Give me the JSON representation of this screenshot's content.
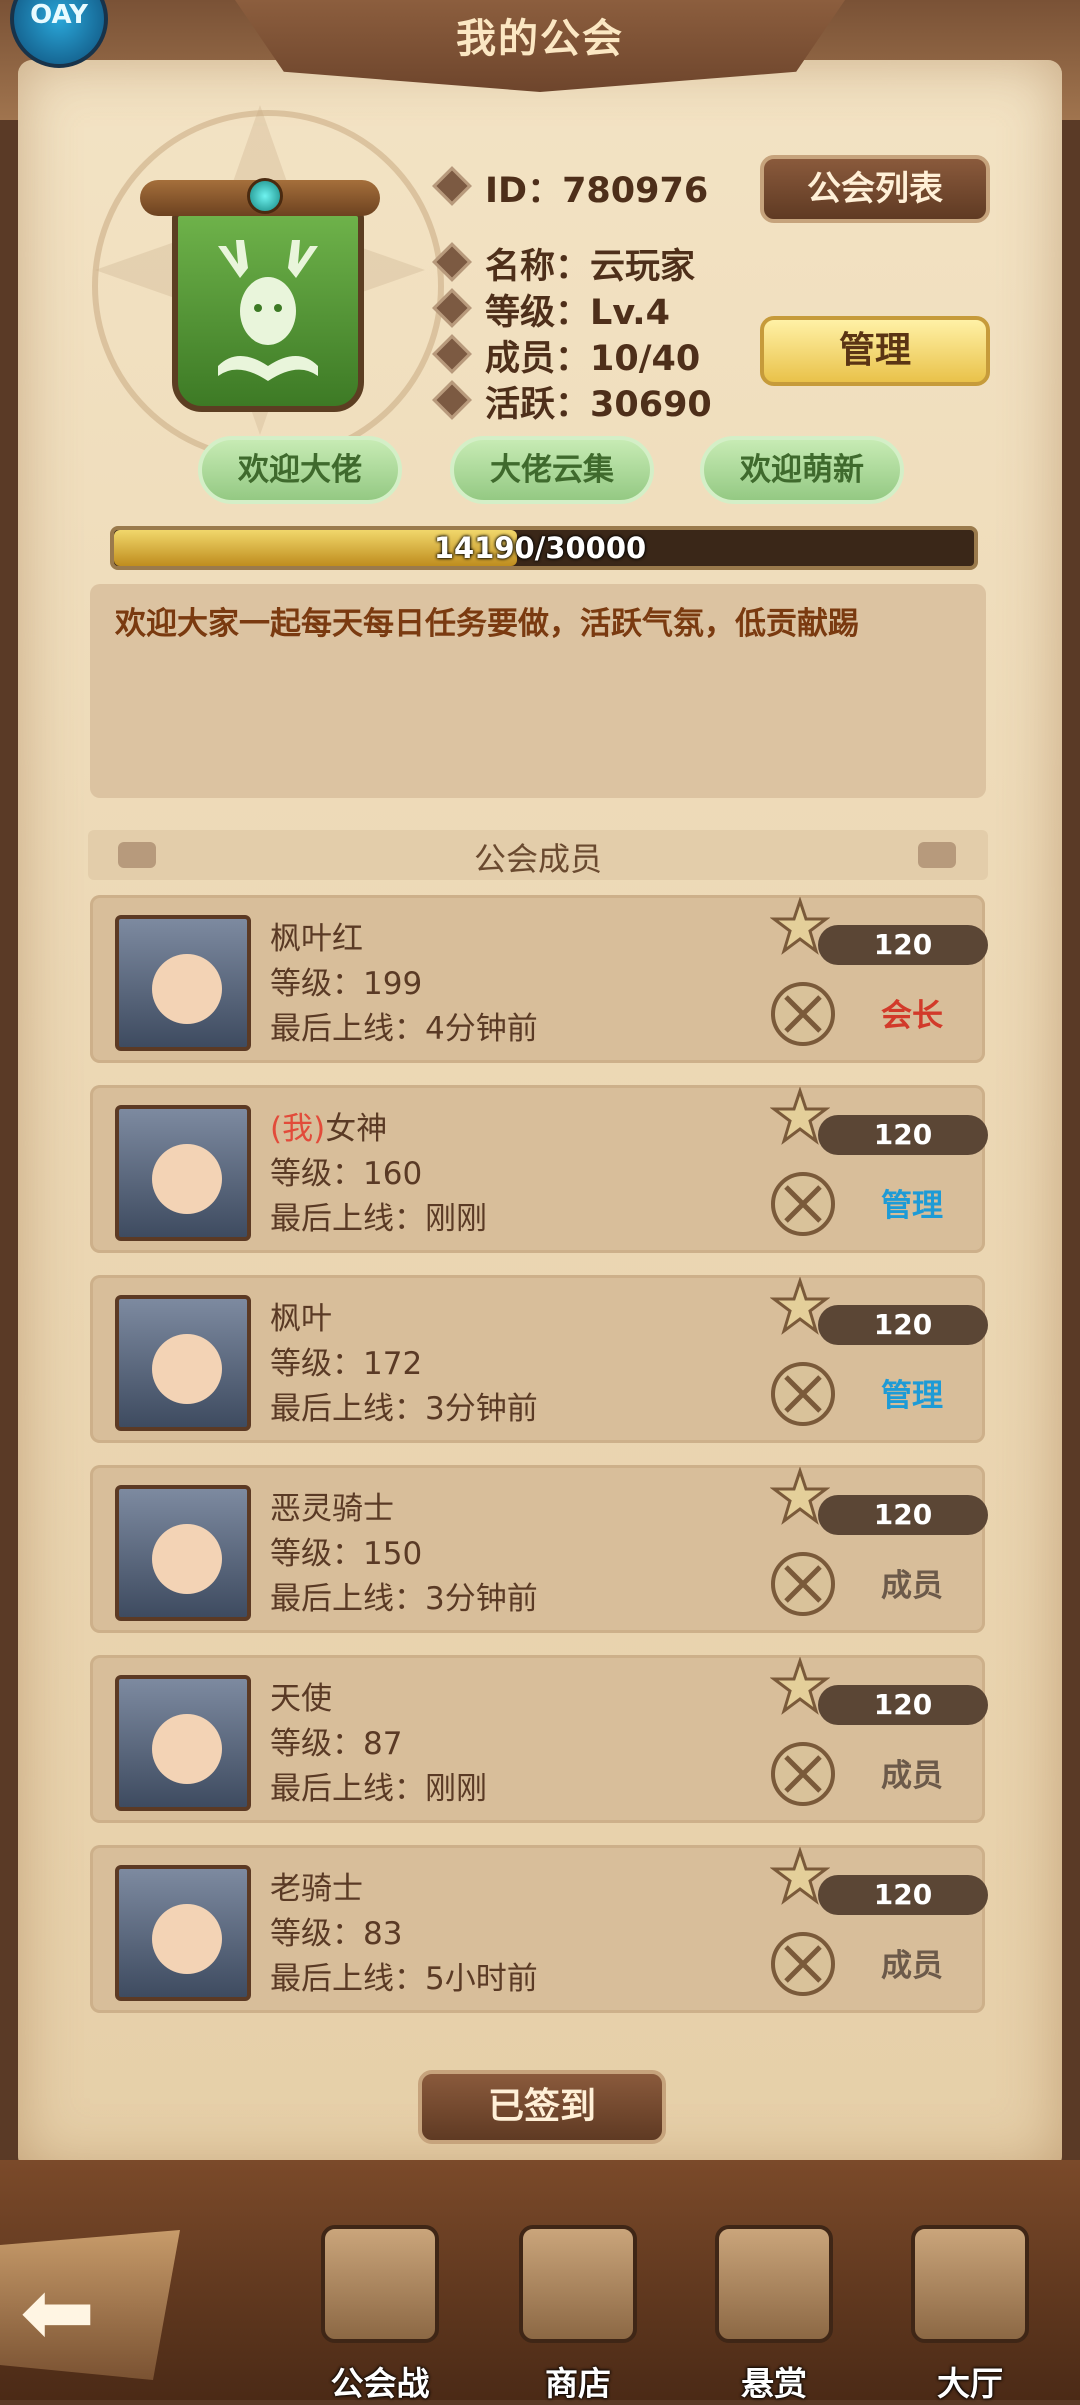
{
  "header": {
    "title": "我的公会",
    "corner_badge": "OAY"
  },
  "guild": {
    "id_label": "ID：",
    "id_value": "780976",
    "name_label": "名称：",
    "name_value": "云玩家",
    "level_label": "等级：",
    "level_value": "Lv.4",
    "members_label": "成员：",
    "members_value": "10/40",
    "activity_label": "活跃：",
    "activity_value": "30690"
  },
  "buttons": {
    "guild_list": "公会列表",
    "manage": "管理",
    "signed": "已签到"
  },
  "tags": [
    "欢迎大佬",
    "大佬云集",
    "欢迎萌新"
  ],
  "progress": {
    "text": "14190/30000",
    "fraction": 0.473
  },
  "notice": "欢迎大家一起每天每日任务要做，活跃气氛，低贡献踢",
  "members_title": "公会成员",
  "members": [
    {
      "prefix": "",
      "name": "枫叶红",
      "level": "等级：199",
      "last_online": "最后上线：4分钟前",
      "power": "120",
      "role": "会长",
      "role_type": "leader"
    },
    {
      "prefix": "(我)",
      "name": "女神",
      "level": "等级：160",
      "last_online": "最后上线：刚刚",
      "power": "120",
      "role": "管理",
      "role_type": "admin"
    },
    {
      "prefix": "",
      "name": "枫叶",
      "level": "等级：172",
      "last_online": "最后上线：3分钟前",
      "power": "120",
      "role": "管理",
      "role_type": "admin"
    },
    {
      "prefix": "",
      "name": "恶灵骑士",
      "level": "等级：150",
      "last_online": "最后上线：3分钟前",
      "power": "120",
      "role": "成员",
      "role_type": "member"
    },
    {
      "prefix": "",
      "name": "天使",
      "level": "等级：87",
      "last_online": "最后上线：刚刚",
      "power": "120",
      "role": "成员",
      "role_type": "member"
    },
    {
      "prefix": "",
      "name": "老骑士",
      "level": "等级：83",
      "last_online": "最后上线：5小时前",
      "power": "120",
      "role": "成员",
      "role_type": "member"
    }
  ],
  "nav": [
    {
      "label": "公会战",
      "icon": "helmet-icon"
    },
    {
      "label": "商店",
      "icon": "shop-icon"
    },
    {
      "label": "悬赏",
      "icon": "bounty-scroll-icon"
    },
    {
      "label": "大厅",
      "icon": "hall-banner-icon"
    }
  ],
  "colors": {
    "leader": "#d23a2a",
    "admin": "#1e9bd6",
    "member": "#6c5a4a"
  }
}
